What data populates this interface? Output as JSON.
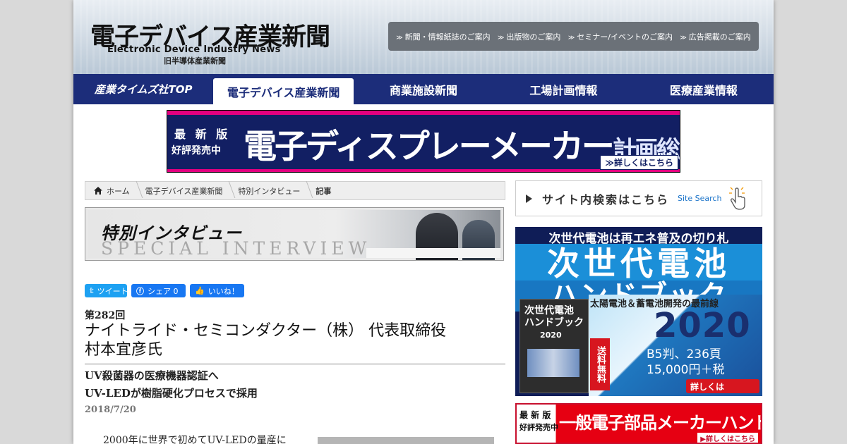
{
  "header": {
    "logo_title": "電子デバイス産業新聞",
    "logo_en": "Electronic Device Industry News",
    "logo_sub": "旧半導体産業新聞",
    "top_links": [
      "新聞・情報紙誌のご案内",
      "出版物のご案内",
      "セミナー/イベントのご案内",
      "広告掲載のご案内"
    ]
  },
  "nav": {
    "tabs": [
      "産業タイムズ社TOP",
      "電子デバイス産業新聞",
      "商業施設新聞",
      "工場計画情報",
      "医療産業情報"
    ],
    "active_index": 1
  },
  "banner": {
    "line1": "最 新 版",
    "line2": "好評発売中",
    "title_main": "電子ディスプレーメーカー",
    "title_tail": "計画総覧",
    "button": "≫詳しくはこちら"
  },
  "breadcrumb": [
    "ホーム",
    "電子デバイス産業新聞",
    "特別インタビュー",
    "記事"
  ],
  "special": {
    "jp": "特別インタビュー",
    "en": "SPECIAL INTERVIEW"
  },
  "social": {
    "tweet": "ツイート",
    "share": "シェア 0",
    "like": "いいね！"
  },
  "article": {
    "number": "第282回",
    "title_line1": "ナイトライド・セミコンダクター（株） 代表取締役",
    "title_line2": "村本宜彦氏",
    "subtitle_line1": "UV殺菌器の医療機器認証へ",
    "subtitle_line2": "UV-LEDが樹脂硬化プロセスで採用",
    "date": "2018/7/20",
    "body_start": "2000年に世界で初めてUV-LEDの量産に"
  },
  "sidebar": {
    "search_label": "サイト内検索はこちら",
    "search_en": "Site Search",
    "ad_battery": {
      "top": "次世代電池は再エネ普及の切り札",
      "title1": "次世代電池",
      "title2": "ハンドブック",
      "book_title1": "次世代電池",
      "book_title2": "ハンドブック",
      "book_year": "2020",
      "caption": "太陽電池＆蓄電池開発の最前線",
      "year": "2020",
      "free": "送料無料",
      "size": "B5判、236頁",
      "price": "15,000円＋税",
      "more": "詳しくは"
    },
    "ad_parts": {
      "line1": "最 新 版",
      "line2": "好評発売中",
      "title": "一般電子部品メーカーハンドブック",
      "more": "▶詳しくはこちら"
    }
  }
}
